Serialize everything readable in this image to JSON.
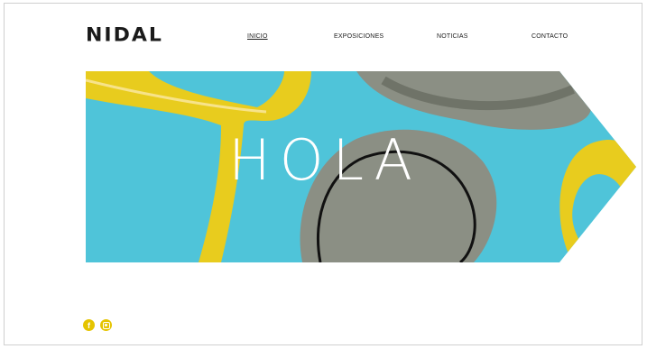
{
  "brand": {
    "logo_text": "NIDAL"
  },
  "nav": {
    "items": [
      {
        "label": "INICIO",
        "active": true
      },
      {
        "label": "EXPOSICIONES",
        "active": false
      },
      {
        "label": "NOTICIAS",
        "active": false
      },
      {
        "label": "CONTACTO",
        "active": false
      }
    ]
  },
  "hero": {
    "title": "HOLA"
  },
  "social": {
    "icons": [
      "facebook-icon",
      "instagram-icon"
    ],
    "accent_color": "#e5c400"
  },
  "colors": {
    "background_blue": "#4fc4d9",
    "yellow": "#e8cc1e",
    "gray": "#8b8f84"
  }
}
